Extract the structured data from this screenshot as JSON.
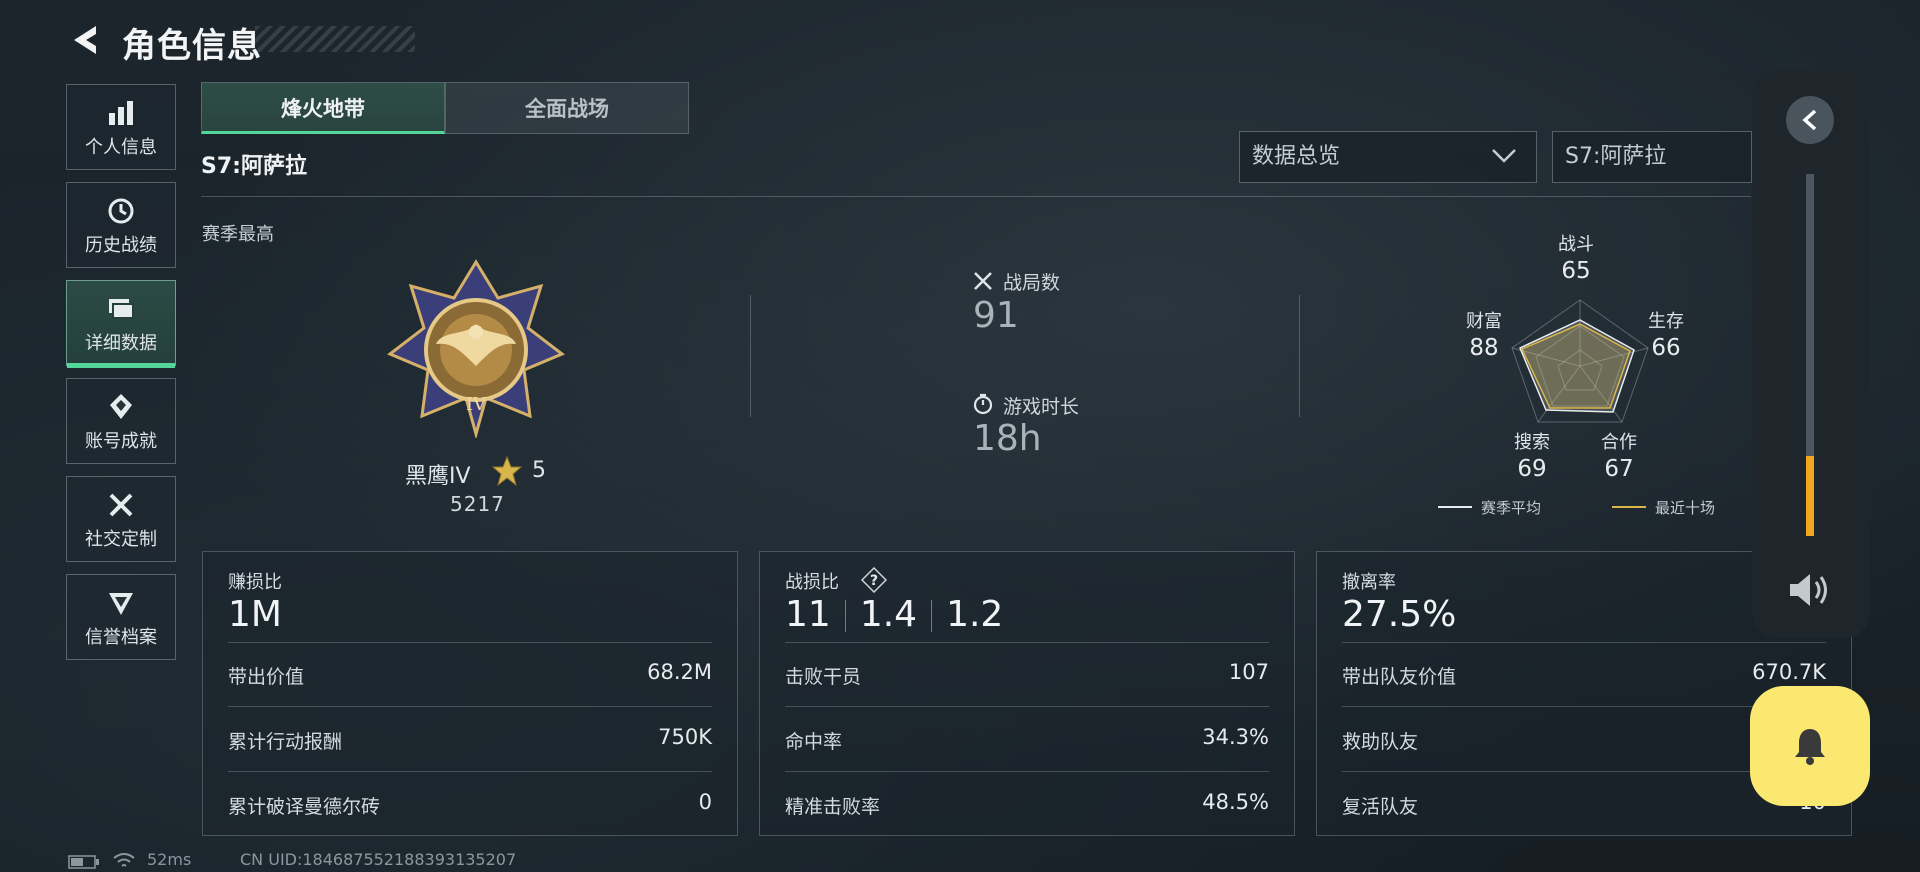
{
  "header": {
    "title": "角色信息"
  },
  "sidebar": {
    "items": [
      {
        "label": "个人信息",
        "icon": "bar-chart-icon"
      },
      {
        "label": "历史战绩",
        "icon": "history-icon"
      },
      {
        "label": "详细数据",
        "icon": "cards-icon",
        "active": true
      },
      {
        "label": "账号成就",
        "icon": "achievement-icon"
      },
      {
        "label": "社交定制",
        "icon": "tools-icon"
      },
      {
        "label": "信誉档案",
        "icon": "badge-icon"
      }
    ]
  },
  "tabs": [
    {
      "label": "烽火地带",
      "active": true
    },
    {
      "label": "全面战场",
      "active": false
    }
  ],
  "season": "S7:阿萨拉",
  "filters": {
    "view_selected": "数据总览",
    "season_selected": "S7:阿萨拉"
  },
  "section_label": "赛季最高",
  "rank": {
    "name": "黑鹰IV",
    "stars": "5",
    "score": "5217"
  },
  "stats": {
    "matches": {
      "label": "战局数",
      "value": "91"
    },
    "playtime": {
      "label": "游戏时长",
      "value": "18h"
    }
  },
  "radar": {
    "axes": [
      {
        "label": "战斗",
        "value": "65"
      },
      {
        "label": "生存",
        "value": "66"
      },
      {
        "label": "合作",
        "value": "67"
      },
      {
        "label": "搜索",
        "value": "69"
      },
      {
        "label": "财富",
        "value": "88"
      }
    ],
    "legend": {
      "season_avg": "赛季平均",
      "recent_ten": "最近十场"
    },
    "colors": {
      "season_avg": "#e8ecef",
      "recent_ten": "#d9b64a"
    }
  },
  "cards": [
    {
      "title": "赚损比",
      "big": "1M",
      "rows": [
        {
          "label": "带出价值",
          "value": "68.2M"
        },
        {
          "label": "累计行动报酬",
          "value": "750K"
        },
        {
          "label": "累计破译曼德尔砖",
          "value": "0"
        }
      ]
    },
    {
      "title": "战损比",
      "kd": [
        "11",
        "1.4",
        "1.2"
      ],
      "rows": [
        {
          "label": "击败干员",
          "value": "107"
        },
        {
          "label": "命中率",
          "value": "34.3%"
        },
        {
          "label": "精准击败率",
          "value": "48.5%"
        }
      ]
    },
    {
      "title": "撤离率",
      "big": "27.5%",
      "rows": [
        {
          "label": "带出队友价值",
          "value": "670.7K"
        },
        {
          "label": "救助队友",
          "value": ""
        },
        {
          "label": "复活队友",
          "value": "10"
        }
      ]
    }
  ],
  "float_panel": {
    "volume_level": 0.22,
    "accent": "#f2a81d"
  },
  "status_bar": {
    "ping": "52ms",
    "uid": "CN UID:1846875521883931352​07"
  }
}
